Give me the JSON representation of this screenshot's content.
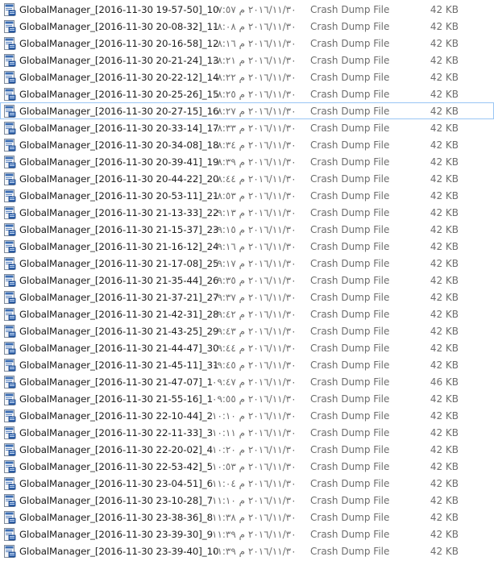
{
  "files": [
    {
      "name": "GlobalManager_[2016-11-30 19-57-50]_10",
      "modified": "٢٠١٦/١١/٣٠ م ٠٧:٥٧",
      "type": "Crash Dump File",
      "size": "42 KB",
      "icon": "dump-file-icon"
    },
    {
      "name": "GlobalManager_[2016-11-30 20-08-32]_11",
      "modified": "٢٠١٦/١١/٣٠ م ٠٨:٠٨",
      "type": "Crash Dump File",
      "size": "42 KB",
      "icon": "dump-file-icon"
    },
    {
      "name": "GlobalManager_[2016-11-30 20-16-58]_12",
      "modified": "٢٠١٦/١١/٣٠ م ٠٨:١٦",
      "type": "Crash Dump File",
      "size": "42 KB",
      "icon": "dump-file-icon"
    },
    {
      "name": "GlobalManager_[2016-11-30 20-21-24]_13",
      "modified": "٢٠١٦/١١/٣٠ م ٠٨:٢١",
      "type": "Crash Dump File",
      "size": "42 KB",
      "icon": "dump-file-icon"
    },
    {
      "name": "GlobalManager_[2016-11-30 20-22-12]_14",
      "modified": "٢٠١٦/١١/٣٠ م ٠٨:٢٢",
      "type": "Crash Dump File",
      "size": "42 KB",
      "icon": "dump-file-icon"
    },
    {
      "name": "GlobalManager_[2016-11-30 20-25-26]_15",
      "modified": "٢٠١٦/١١/٣٠ م ٠٨:٢٥",
      "type": "Crash Dump File",
      "size": "42 KB",
      "icon": "dump-file-icon"
    },
    {
      "name": "GlobalManager_[2016-11-30 20-27-15]_16",
      "modified": "٢٠١٦/١١/٣٠ م ٠٨:٢٧",
      "type": "Crash Dump File",
      "size": "42 KB",
      "icon": "dump-file-icon",
      "hovered": true
    },
    {
      "name": "GlobalManager_[2016-11-30 20-33-14]_17",
      "modified": "٢٠١٦/١١/٣٠ م ٠٨:٣٣",
      "type": "Crash Dump File",
      "size": "42 KB",
      "icon": "dump-file-icon"
    },
    {
      "name": "GlobalManager_[2016-11-30 20-34-08]_18",
      "modified": "٢٠١٦/١١/٣٠ م ٠٨:٣٤",
      "type": "Crash Dump File",
      "size": "42 KB",
      "icon": "dump-file-icon"
    },
    {
      "name": "GlobalManager_[2016-11-30 20-39-41]_19",
      "modified": "٢٠١٦/١١/٣٠ م ٠٨:٣٩",
      "type": "Crash Dump File",
      "size": "42 KB",
      "icon": "dump-file-icon"
    },
    {
      "name": "GlobalManager_[2016-11-30 20-44-22]_20",
      "modified": "٢٠١٦/١١/٣٠ م ٠٨:٤٤",
      "type": "Crash Dump File",
      "size": "42 KB",
      "icon": "dump-file-icon"
    },
    {
      "name": "GlobalManager_[2016-11-30 20-53-11]_21",
      "modified": "٢٠١٦/١١/٣٠ م ٠٨:٥٣",
      "type": "Crash Dump File",
      "size": "42 KB",
      "icon": "dump-file-icon"
    },
    {
      "name": "GlobalManager_[2016-11-30 21-13-33]_22",
      "modified": "٢٠١٦/١١/٣٠ م ٠٩:١٣",
      "type": "Crash Dump File",
      "size": "42 KB",
      "icon": "dump-file-icon"
    },
    {
      "name": "GlobalManager_[2016-11-30 21-15-37]_23",
      "modified": "٢٠١٦/١١/٣٠ م ٠٩:١٥",
      "type": "Crash Dump File",
      "size": "42 KB",
      "icon": "dump-file-icon"
    },
    {
      "name": "GlobalManager_[2016-11-30 21-16-12]_24",
      "modified": "٢٠١٦/١١/٣٠ م ٠٩:١٦",
      "type": "Crash Dump File",
      "size": "42 KB",
      "icon": "dump-file-icon"
    },
    {
      "name": "GlobalManager_[2016-11-30 21-17-08]_25",
      "modified": "٢٠١٦/١١/٣٠ م ٠٩:١٧",
      "type": "Crash Dump File",
      "size": "42 KB",
      "icon": "dump-file-icon"
    },
    {
      "name": "GlobalManager_[2016-11-30 21-35-44]_26",
      "modified": "٢٠١٦/١١/٣٠ م ٠٩:٣٥",
      "type": "Crash Dump File",
      "size": "42 KB",
      "icon": "dump-file-icon"
    },
    {
      "name": "GlobalManager_[2016-11-30 21-37-21]_27",
      "modified": "٢٠١٦/١١/٣٠ م ٠٩:٣٧",
      "type": "Crash Dump File",
      "size": "42 KB",
      "icon": "dump-file-icon"
    },
    {
      "name": "GlobalManager_[2016-11-30 21-42-31]_28",
      "modified": "٢٠١٦/١١/٣٠ م ٠٩:٤٢",
      "type": "Crash Dump File",
      "size": "42 KB",
      "icon": "dump-file-icon"
    },
    {
      "name": "GlobalManager_[2016-11-30 21-43-25]_29",
      "modified": "٢٠١٦/١١/٣٠ م ٠٩:٤٣",
      "type": "Crash Dump File",
      "size": "42 KB",
      "icon": "dump-file-icon"
    },
    {
      "name": "GlobalManager_[2016-11-30 21-44-47]_30",
      "modified": "٢٠١٦/١١/٣٠ م ٠٩:٤٤",
      "type": "Crash Dump File",
      "size": "42 KB",
      "icon": "dump-file-icon"
    },
    {
      "name": "GlobalManager_[2016-11-30 21-45-11]_31",
      "modified": "٢٠١٦/١١/٣٠ م ٠٩:٤٥",
      "type": "Crash Dump File",
      "size": "42 KB",
      "icon": "dump-file-icon"
    },
    {
      "name": "GlobalManager_[2016-11-30 21-47-07]_1",
      "modified": "٢٠١٦/١١/٣٠ م ٠٩:٤٧",
      "type": "Crash Dump File",
      "size": "46 KB",
      "icon": "dump-file-icon"
    },
    {
      "name": "GlobalManager_[2016-11-30 21-55-16]_1",
      "modified": "٢٠١٦/١١/٣٠ م ٠٩:٥٥",
      "type": "Crash Dump File",
      "size": "42 KB",
      "icon": "dump-file-icon"
    },
    {
      "name": "GlobalManager_[2016-11-30 22-10-44]_2",
      "modified": "٢٠١٦/١١/٣٠ م ١٠:١٠",
      "type": "Crash Dump File",
      "size": "42 KB",
      "icon": "dump-file-icon"
    },
    {
      "name": "GlobalManager_[2016-11-30 22-11-33]_3",
      "modified": "٢٠١٦/١١/٣٠ م ١٠:١١",
      "type": "Crash Dump File",
      "size": "42 KB",
      "icon": "dump-file-icon"
    },
    {
      "name": "GlobalManager_[2016-11-30 22-20-02]_4",
      "modified": "٢٠١٦/١١/٣٠ م ١٠:٢٠",
      "type": "Crash Dump File",
      "size": "42 KB",
      "icon": "dump-file-icon"
    },
    {
      "name": "GlobalManager_[2016-11-30 22-53-42]_5",
      "modified": "٢٠١٦/١١/٣٠ م ١٠:٥٣",
      "type": "Crash Dump File",
      "size": "42 KB",
      "icon": "dump-file-icon"
    },
    {
      "name": "GlobalManager_[2016-11-30 23-04-51]_6",
      "modified": "٢٠١٦/١١/٣٠ م ١١:٠٤",
      "type": "Crash Dump File",
      "size": "42 KB",
      "icon": "dump-file-icon"
    },
    {
      "name": "GlobalManager_[2016-11-30 23-10-28]_7",
      "modified": "٢٠١٦/١١/٣٠ م ١١:١٠",
      "type": "Crash Dump File",
      "size": "42 KB",
      "icon": "dump-file-icon"
    },
    {
      "name": "GlobalManager_[2016-11-30 23-38-36]_8",
      "modified": "٢٠١٦/١١/٣٠ م ١١:٣٨",
      "type": "Crash Dump File",
      "size": "42 KB",
      "icon": "dump-file-icon"
    },
    {
      "name": "GlobalManager_[2016-11-30 23-39-30]_9",
      "modified": "٢٠١٦/١١/٣٠ م ١١:٣٩",
      "type": "Crash Dump File",
      "size": "42 KB",
      "icon": "dump-file-icon"
    },
    {
      "name": "GlobalManager_[2016-11-30 23-39-40]_10",
      "modified": "٢٠١٦/١١/٣٠ م ١١:٣٩",
      "type": "Crash Dump File",
      "size": "42 KB",
      "icon": "dump-file-icon"
    }
  ],
  "colors": {
    "hover_border": "#9ac6f4",
    "name_text": "#1e1e1e",
    "detail_text": "#6d6d6d"
  }
}
